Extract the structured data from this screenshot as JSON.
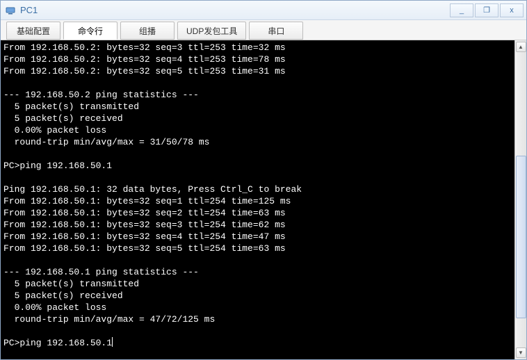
{
  "window": {
    "title": "PC1"
  },
  "tabs": [
    {
      "label": "基础配置",
      "active": false
    },
    {
      "label": "命令行",
      "active": true
    },
    {
      "label": "组播",
      "active": false
    },
    {
      "label": "UDP发包工具",
      "active": false
    },
    {
      "label": "串口",
      "active": false
    }
  ],
  "terminal": {
    "lines": [
      "From 192.168.50.2: bytes=32 seq=3 ttl=253 time=32 ms",
      "From 192.168.50.2: bytes=32 seq=4 ttl=253 time=78 ms",
      "From 192.168.50.2: bytes=32 seq=5 ttl=253 time=31 ms",
      "",
      "--- 192.168.50.2 ping statistics ---",
      "  5 packet(s) transmitted",
      "  5 packet(s) received",
      "  0.00% packet loss",
      "  round-trip min/avg/max = 31/50/78 ms",
      "",
      "PC>ping 192.168.50.1",
      "",
      "Ping 192.168.50.1: 32 data bytes, Press Ctrl_C to break",
      "From 192.168.50.1: bytes=32 seq=1 ttl=254 time=125 ms",
      "From 192.168.50.1: bytes=32 seq=2 ttl=254 time=63 ms",
      "From 192.168.50.1: bytes=32 seq=3 ttl=254 time=62 ms",
      "From 192.168.50.1: bytes=32 seq=4 ttl=254 time=47 ms",
      "From 192.168.50.1: bytes=32 seq=5 ttl=254 time=63 ms",
      "",
      "--- 192.168.50.1 ping statistics ---",
      "  5 packet(s) transmitted",
      "  5 packet(s) received",
      "  0.00% packet loss",
      "  round-trip min/avg/max = 47/72/125 ms",
      ""
    ],
    "prompt": "PC>",
    "current_input": "ping 192.168.50.1"
  },
  "win_controls": {
    "minimize": "_",
    "restore": "❐",
    "close": "x"
  }
}
